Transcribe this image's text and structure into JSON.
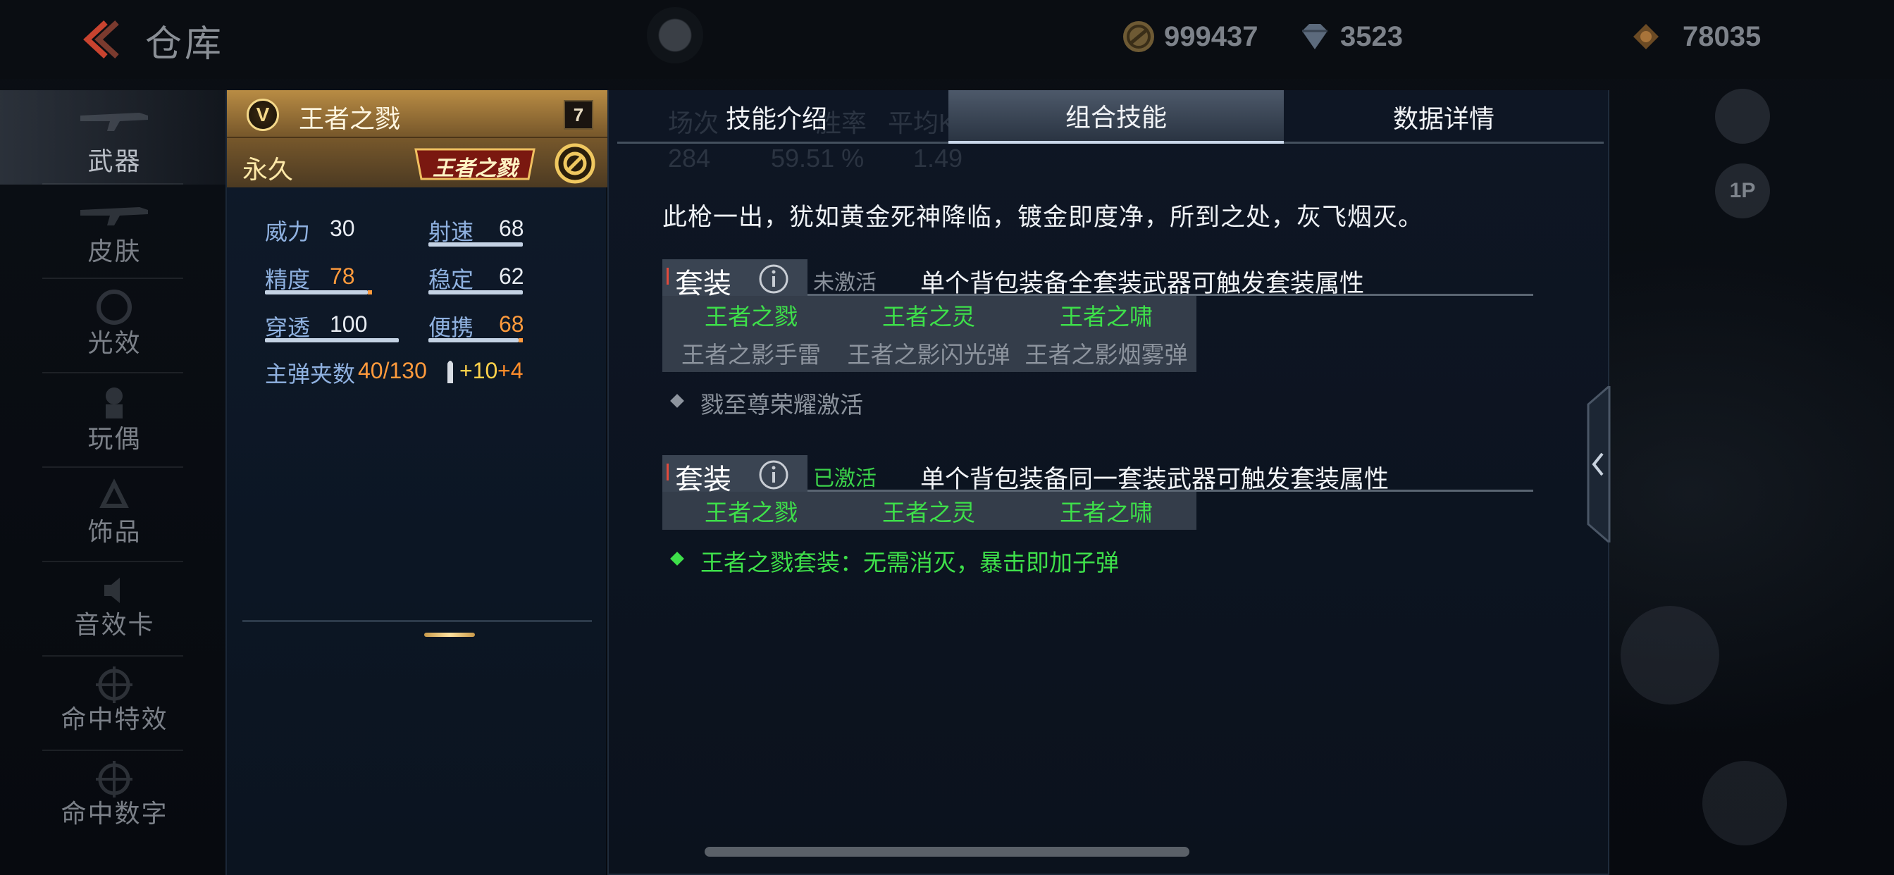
{
  "topbar": {
    "title": "仓库",
    "currencies": [
      {
        "icon": "gold-coin-icon",
        "value": "999437"
      },
      {
        "icon": "diamond-icon",
        "value": "3523"
      },
      {
        "icon": "ticket-icon",
        "value": "78035"
      }
    ]
  },
  "sidebar": {
    "items": [
      {
        "label": "武器",
        "active": true
      },
      {
        "label": "皮肤"
      },
      {
        "label": "光效"
      },
      {
        "label": "玩偶"
      },
      {
        "label": "饰品"
      },
      {
        "label": "音效卡"
      },
      {
        "label": "命中特效"
      },
      {
        "label": "命中数字"
      }
    ]
  },
  "weapon": {
    "rank_badge": "V",
    "name": "王者之戮",
    "level": "7",
    "duration": "永久",
    "series_tag": "王者之戮",
    "stats": [
      {
        "label": "威力",
        "value": "30",
        "highlight": false,
        "fill": 0.3
      },
      {
        "label": "射速",
        "value": "68",
        "highlight": false,
        "fill": 0.68
      },
      {
        "label": "精度",
        "value": "78",
        "highlight": true,
        "fill": 0.78
      },
      {
        "label": "稳定",
        "value": "62",
        "highlight": false,
        "fill": 0.62
      },
      {
        "label": "穿透",
        "value": "100",
        "highlight": false,
        "fill": 1.0
      },
      {
        "label": "便携",
        "value": "68",
        "highlight": true,
        "fill": 0.68
      }
    ],
    "ammo_label": "主弹夹数",
    "ammo_value": "40/130",
    "ammo_bonus_1": "+10",
    "ammo_bonus_2": "+4"
  },
  "tabs": {
    "skill_intro": "技能介绍",
    "combo": "组合技能",
    "data_detail": "数据详情"
  },
  "ghost_stats": {
    "col1_label": "场次",
    "col1_value": "284",
    "col2_label": "胜率",
    "col2_value": "59.51 %",
    "col3_label": "平均KDA",
    "col3_value": "1.49"
  },
  "flavor_text": "此枪一出，犹如黄金死神降临，镀金即度净，所到之处，灰飞烟灭。",
  "sets": [
    {
      "chip_label": "套装",
      "status": "未激活",
      "status_active": false,
      "description": "单个背包装备全套装武器可触发套装属性",
      "items": [
        {
          "name": "王者之戮",
          "active": true
        },
        {
          "name": "王者之灵",
          "active": true
        },
        {
          "name": "王者之啸",
          "active": true
        },
        {
          "name": "王者之影手雷",
          "active": false
        },
        {
          "name": "王者之影闪光弹",
          "active": false
        },
        {
          "name": "王者之影烟雾弹",
          "active": false
        }
      ],
      "effect": "戮至尊荣耀激活",
      "effect_active": false
    },
    {
      "chip_label": "套装",
      "status": "已激活",
      "status_active": true,
      "description": "单个背包装备同一套装武器可触发套装属性",
      "items": [
        {
          "name": "王者之戮",
          "active": true
        },
        {
          "name": "王者之灵",
          "active": true
        },
        {
          "name": "王者之啸",
          "active": true
        }
      ],
      "effect": "王者之戮套装：无需消灭，暴击即加子弹",
      "effect_active": true
    }
  ],
  "right_controls": {
    "view_toggle": "1P"
  },
  "colors": {
    "gold_header": "#b98c44",
    "stat_label": "#8fb1e0",
    "highlight_orange": "#ff9a3c",
    "active_green": "#3ee04a",
    "inactive_gray": "#8d949e"
  }
}
